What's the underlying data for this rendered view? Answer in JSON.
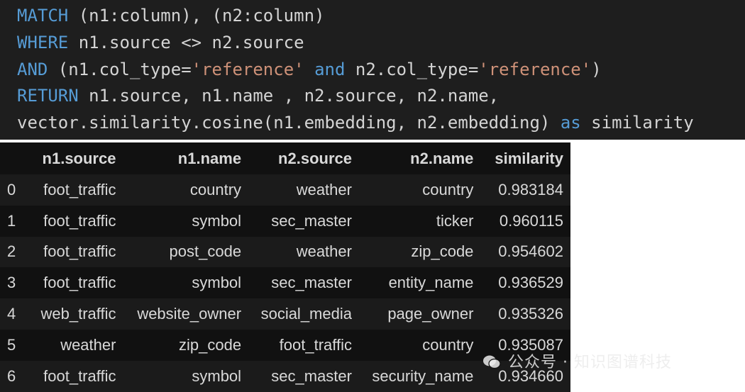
{
  "code": {
    "lines": [
      [
        {
          "t": "MATCH",
          "k": "kw"
        },
        {
          "t": " (n1:column), (n2:column)",
          "k": "plain"
        }
      ],
      [
        {
          "t": "WHERE",
          "k": "kw"
        },
        {
          "t": " n1.source <> n2.source",
          "k": "plain"
        }
      ],
      [
        {
          "t": "AND",
          "k": "kw"
        },
        {
          "t": " (n1.col_type=",
          "k": "plain"
        },
        {
          "t": "'reference'",
          "k": "str"
        },
        {
          "t": " ",
          "k": "plain"
        },
        {
          "t": "and",
          "k": "kw"
        },
        {
          "t": " n2.col_type=",
          "k": "plain"
        },
        {
          "t": "'reference'",
          "k": "str"
        },
        {
          "t": ")",
          "k": "plain"
        }
      ],
      [
        {
          "t": "RETURN",
          "k": "kw"
        },
        {
          "t": " n1.source, n1.name , n2.source, n2.name,",
          "k": "plain"
        }
      ],
      [
        {
          "t": "vector.similarity.cosine(n1.embedding, n2.embedding) ",
          "k": "plain"
        },
        {
          "t": "as",
          "k": "kw"
        },
        {
          "t": " similarity",
          "k": "plain"
        }
      ]
    ]
  },
  "table": {
    "columns": [
      "",
      "n1.source",
      "n1.name",
      "n2.source",
      "n2.name",
      "similarity"
    ],
    "rows": [
      [
        "0",
        "foot_traffic",
        "country",
        "weather",
        "country",
        "0.983184"
      ],
      [
        "1",
        "foot_traffic",
        "symbol",
        "sec_master",
        "ticker",
        "0.960115"
      ],
      [
        "2",
        "foot_traffic",
        "post_code",
        "weather",
        "zip_code",
        "0.954602"
      ],
      [
        "3",
        "foot_traffic",
        "symbol",
        "sec_master",
        "entity_name",
        "0.936529"
      ],
      [
        "4",
        "web_traffic",
        "website_owner",
        "social_media",
        "page_owner",
        "0.935326"
      ],
      [
        "5",
        "weather",
        "zip_code",
        "foot_traffic",
        "country",
        "0.935087"
      ],
      [
        "6",
        "foot_traffic",
        "symbol",
        "sec_master",
        "security_name",
        "0.934660"
      ]
    ]
  },
  "watermark": {
    "text": "公众号 · 知识图谱科技",
    "icon": "wechat-icon"
  }
}
